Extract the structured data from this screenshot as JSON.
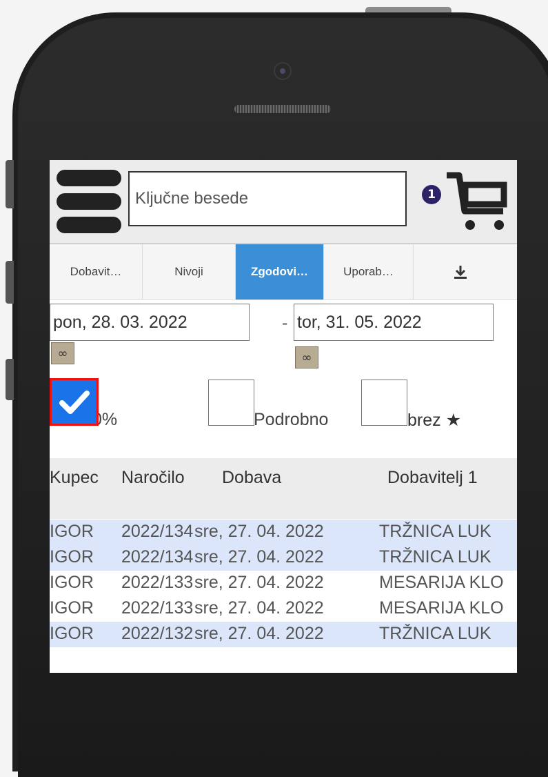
{
  "search": {
    "placeholder": "Ključne besede"
  },
  "cart": {
    "count": "1"
  },
  "tabs": [
    {
      "label": "Dobavit…",
      "active": false
    },
    {
      "label": "Nivoji",
      "active": false
    },
    {
      "label": "Zgodovi…",
      "active": true
    },
    {
      "label": "Uporab…",
      "active": false
    }
  ],
  "download_icon": "download-icon",
  "filters": {
    "date_from": "pon, 28. 03. 2022",
    "separator": "-",
    "date_to": "tor, 31. 05. 2022",
    "infinity": "∞",
    "checkbox_1_label": "0%",
    "checkbox_1_checked": true,
    "checkbox_2_label": "Podrobno",
    "checkbox_2_checked": false,
    "checkbox_3_label": "brez ★",
    "checkbox_3_checked": false
  },
  "table": {
    "headers": [
      "Kupec",
      "Naročilo",
      "Dobava",
      "Dobavitelj 1"
    ],
    "rows": [
      {
        "kupec": "IGOR",
        "narocilo": "2022/134",
        "dobava": "sre, 27. 04. 2022",
        "dobavitelj": "TRŽNICA LUK",
        "highlight": true
      },
      {
        "kupec": "IGOR",
        "narocilo": "2022/134",
        "dobava": "sre, 27. 04. 2022",
        "dobavitelj": "TRŽNICA LUK",
        "highlight": true
      },
      {
        "kupec": "IGOR",
        "narocilo": "2022/133",
        "dobava": "sre, 27. 04. 2022",
        "dobavitelj": "MESARIJA KLO",
        "highlight": false
      },
      {
        "kupec": "IGOR",
        "narocilo": "2022/133",
        "dobava": "sre, 27. 04. 2022",
        "dobavitelj": "MESARIJA KLO",
        "highlight": false
      },
      {
        "kupec": "IGOR",
        "narocilo": "2022/132",
        "dobava": "sre, 27. 04. 2022",
        "dobavitelj": "TRŽNICA LUK",
        "highlight": true
      }
    ]
  },
  "colors": {
    "active_tab": "#3a8fd6",
    "row_highlight": "#dbe6fb",
    "checkbox_checked": "#1a73e8",
    "focus_outline": "#ee1111"
  }
}
